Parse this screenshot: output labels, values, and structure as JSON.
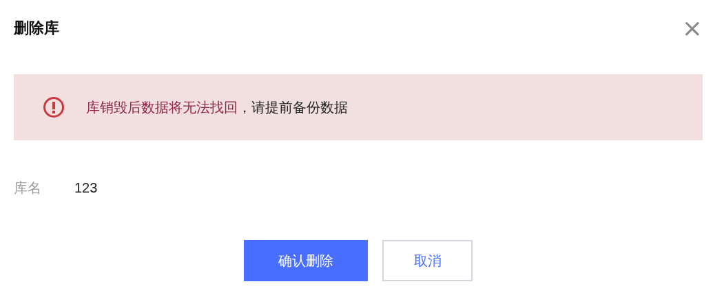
{
  "dialog": {
    "title": "删除库",
    "close": "×"
  },
  "alert": {
    "message_emphasis": "库销毁后数据将无法找回",
    "message_rest": "，请提前备份数据"
  },
  "fields": [
    {
      "label": "库名",
      "value": "123"
    }
  ],
  "buttons": [
    {
      "label": "确认删除",
      "kind": "primary"
    },
    {
      "label": "取消",
      "kind": "secondary"
    }
  ]
}
